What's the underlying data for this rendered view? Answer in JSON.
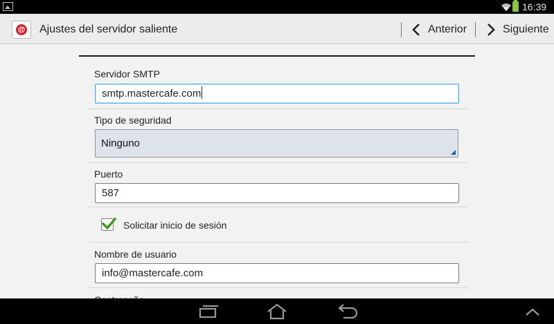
{
  "status_bar": {
    "time": "16:39"
  },
  "action_bar": {
    "title": "Ajustes del servidor saliente",
    "prev_label": "Anterior",
    "next_label": "Siguiente"
  },
  "form": {
    "smtp_server": {
      "label": "Servidor SMTP",
      "value": "smtp.mastercafe.com"
    },
    "security_type": {
      "label": "Tipo de seguridad",
      "value": "Ninguno"
    },
    "port": {
      "label": "Puerto",
      "value": "587"
    },
    "require_signin": {
      "label": "Solicitar inicio de sesión",
      "checked": true
    },
    "username": {
      "label": "Nombre de usuario",
      "value": "info@mastercafe.com"
    },
    "password": {
      "label": "Contraseña"
    }
  },
  "colors": {
    "focus_border": "#4db6e8",
    "check_green": "#3a9a1e",
    "battery": "#8ac63f",
    "app_icon_red": "#d2232a"
  }
}
